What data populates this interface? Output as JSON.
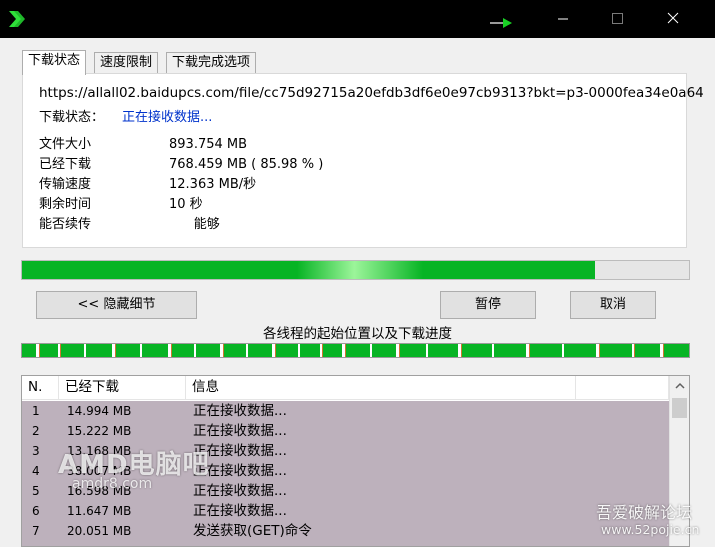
{
  "titlebar": {
    "icons": [
      "app-chevron-icon",
      "green-arrow-icon",
      "minimize-icon",
      "maximize-icon",
      "close-icon"
    ]
  },
  "tabs": [
    {
      "label": "下载状态",
      "active": true
    },
    {
      "label": "速度限制",
      "active": false
    },
    {
      "label": "下载完成选项",
      "active": false
    }
  ],
  "download": {
    "url": "https://allall02.baidupcs.com/file/cc75d92715a20efdb3df6e0e97cb9313?bkt=p3-0000fea34e0a64",
    "status_label": "下载状态：",
    "status_value": "正在接收数据...",
    "rows": [
      {
        "label": "文件大小",
        "value": "893.754  MB"
      },
      {
        "label": "已经下载",
        "value": "768.459  MB  ( 85.98 % )"
      },
      {
        "label": "传输速度",
        "value": "12.363  MB/秒"
      },
      {
        "label": "剩余时间",
        "value": "10 秒"
      },
      {
        "label": "能否续传",
        "value": "      能够"
      }
    ],
    "progress_percent": 85.98
  },
  "buttons": {
    "hide_details": "<< 隐藏细节",
    "pause": "暂停",
    "cancel": "取消"
  },
  "threads": {
    "label": "各线程的起始位置以及下载进度"
  },
  "list": {
    "columns": [
      "N.",
      "已经下载",
      "信息",
      ""
    ],
    "rows": [
      {
        "n": "1",
        "downloaded": "14.994  MB",
        "info": "正在接收数据..."
      },
      {
        "n": "2",
        "downloaded": "15.222  MB",
        "info": "正在接收数据..."
      },
      {
        "n": "3",
        "downloaded": "13.168  MB",
        "info": "正在接收数据..."
      },
      {
        "n": "4",
        "downloaded": "38.007  MB",
        "info": "正在接收数据..."
      },
      {
        "n": "5",
        "downloaded": "16.598  MB",
        "info": "正在接收数据..."
      },
      {
        "n": "6",
        "downloaded": "11.647  MB",
        "info": "正在接收数据..."
      },
      {
        "n": "7",
        "downloaded": "20.051  MB",
        "info": "发送获取(GET)命令"
      }
    ]
  },
  "watermarks": {
    "left": "AMD电脑吧",
    "left_sub": "amdr8.com",
    "right": "吾爱破解论坛",
    "right_sub": "www.52pojie.cn"
  },
  "colors": {
    "accent_green": "#07b424",
    "titlebar": "#000000",
    "list_selection": "#bdb1bc",
    "status_blue": "#0033cc"
  }
}
